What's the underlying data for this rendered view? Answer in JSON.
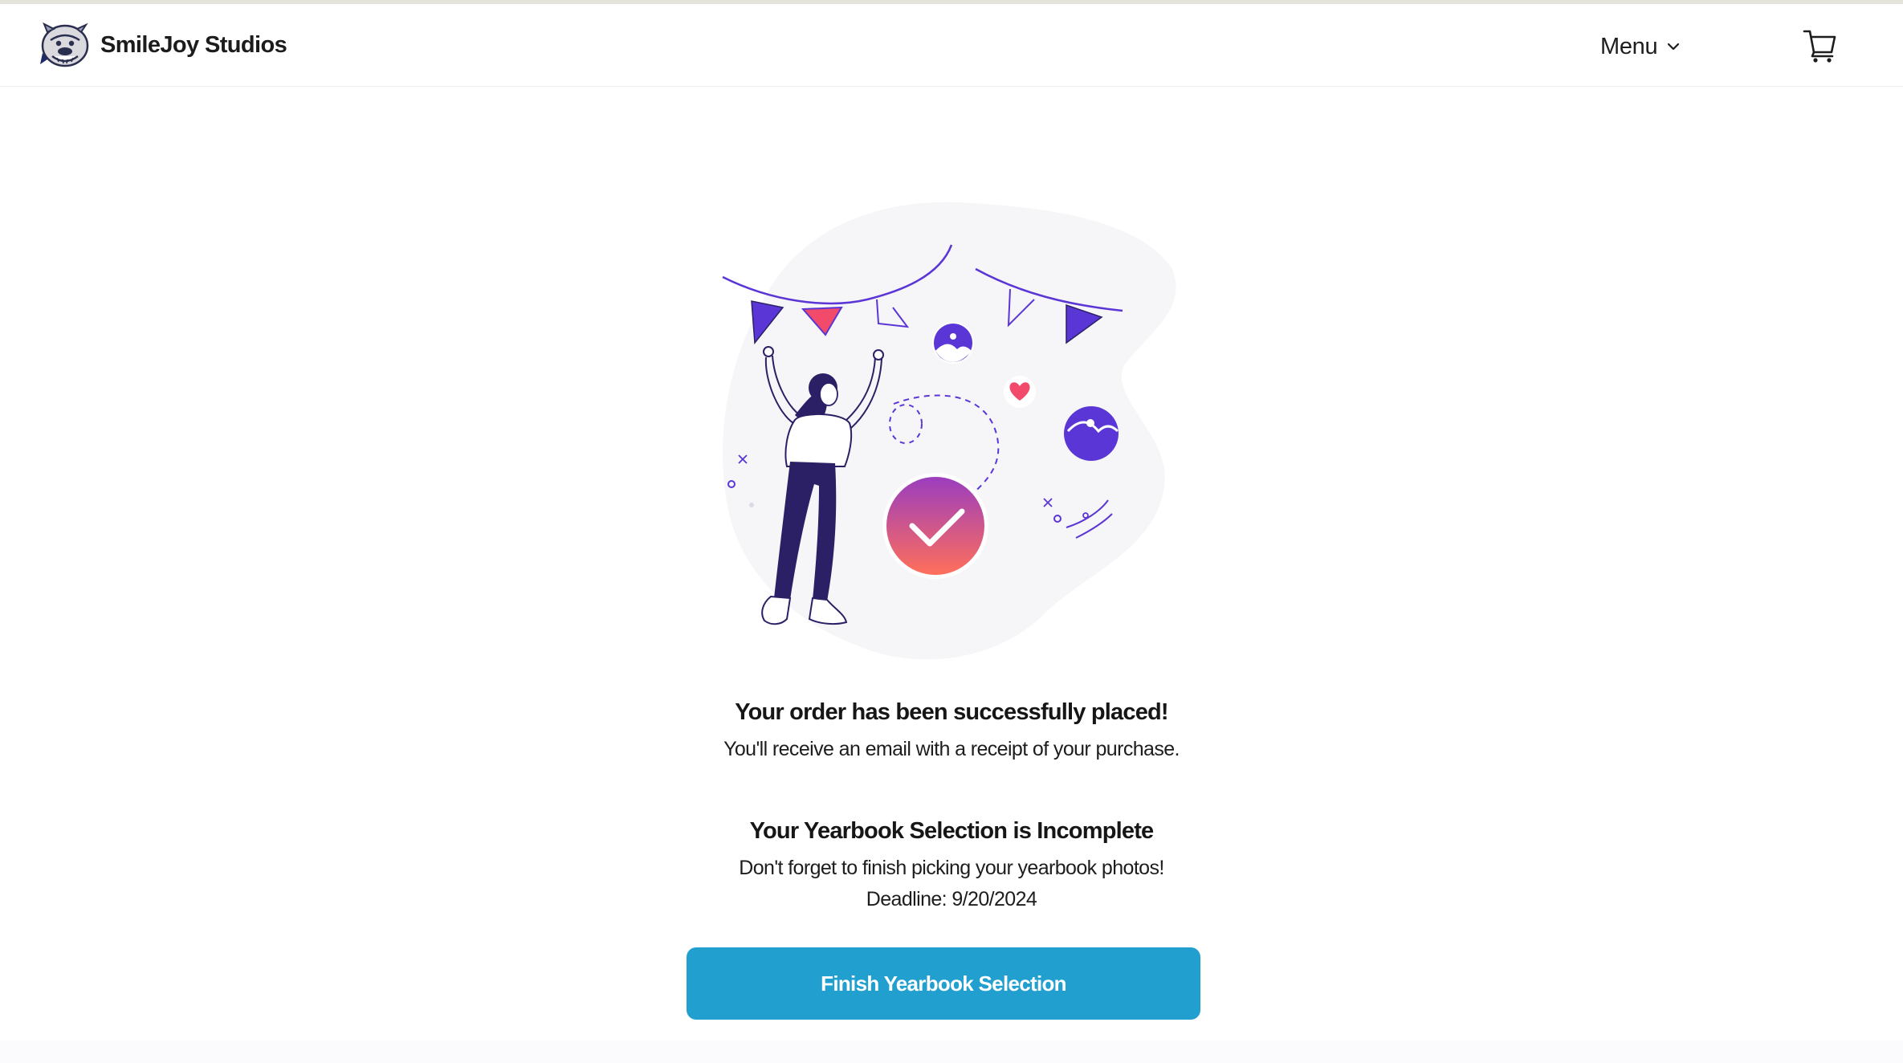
{
  "header": {
    "brand_name": "SmileJoy Studios",
    "logo_icon": "bulldog-mascot-icon",
    "menu_label": "Menu",
    "menu_icon": "chevron-down-icon",
    "cart_icon": "shopping-cart-icon"
  },
  "illustration": {
    "description_icon": "celebration-illustration",
    "check_icon": "check-circle-icon",
    "colors": {
      "accent_purple": "#5b36d6",
      "gradient_top": "#9b3dbf",
      "gradient_bottom": "#ff6f5a",
      "heart": "#f24a6a",
      "blob": "#f6f5f7",
      "figure_dark": "#2b2066"
    }
  },
  "confirmation": {
    "title": "Your order has been successfully placed!",
    "subtitle": "You'll receive an email with a receipt of your purchase."
  },
  "yearbook": {
    "title": "Your Yearbook Selection is Incomplete",
    "message": "Don't forget to finish picking your yearbook photos!",
    "deadline": "Deadline: 9/20/2024",
    "button_label": "Finish Yearbook Selection",
    "button_color": "#219fcf"
  }
}
